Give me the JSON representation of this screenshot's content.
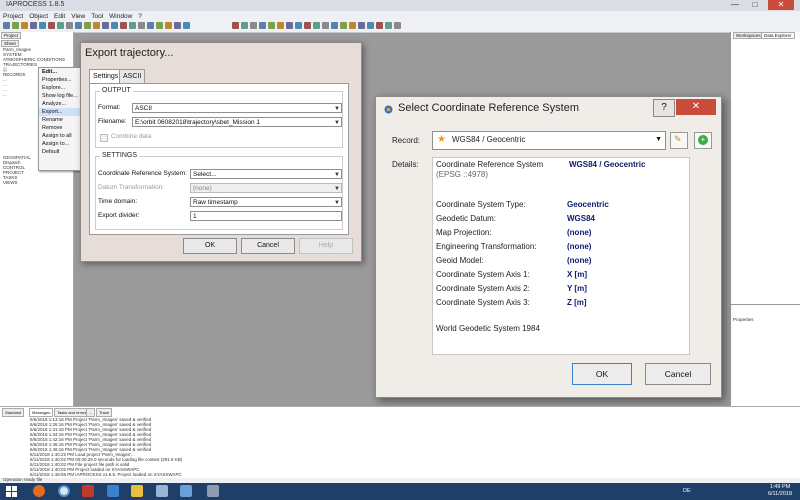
{
  "app": {
    "title": "IAPROCESS 1.8.5"
  },
  "menu": [
    "Project",
    "Object",
    "Edit",
    "View",
    "Tool",
    "Window",
    "?"
  ],
  "left_tabs": [
    "Project",
    "Sheet"
  ],
  "tree": [
    "Parm_Images",
    "SYSTEM",
    "ATMOSPHERIC CONDITIONS",
    "TRAJECTORIES",
    "...",
    "RECORDS",
    "...",
    "...",
    "...",
    "...",
    "GEOSPATIAL",
    "Dispatch",
    "CONTROL",
    "PROJECT",
    "TASKS",
    "VIEWS"
  ],
  "context_menu": [
    "Edit...",
    "Properties...",
    "Explore...",
    "Show log file...",
    "Analyze...",
    "Export...",
    "Rename",
    "Remove",
    "Assign to all",
    "Assign to...",
    "Default"
  ],
  "right_tabs": [
    "Workspaces",
    "Data Explorer"
  ],
  "right_props_label": "Properties",
  "export": {
    "title": "Export trajectory...",
    "tabs": [
      "Settings",
      "ASCII"
    ],
    "output_label": "OUTPUT",
    "format_label": "Format:",
    "format_value": "ASCII",
    "filename_label": "Filename:",
    "filename_value": "E:\\orbit 06082018\\trajectory\\sbet_Mission 1",
    "combine_label": "Combine data",
    "settings_label": "SETTINGS",
    "crs_label": "Coordinate Reference System:",
    "crs_value": "Select...",
    "datum_label": "Datum Transformation:",
    "datum_value": "(none)",
    "time_label": "Time domain:",
    "time_value": "Raw timestamp",
    "divider_label": "Export divider:",
    "divider_value": "1",
    "ok": "OK",
    "cancel": "Cancel",
    "help": "Help"
  },
  "crs": {
    "title": "Select Coordinate Reference System",
    "help_btn": "?",
    "record_label": "Record:",
    "record_value": "WGS84 / Geocentric",
    "details_label": "Details:",
    "desc_prefix": "Coordinate Reference System",
    "desc_name": "WGS84 / Geocentric",
    "desc_epsg": "(EPSG ::4978)",
    "rows": [
      {
        "label": "Coordinate System Type:",
        "value": "Geocentric"
      },
      {
        "label": "Geodetic Datum:",
        "value": "WGS84"
      },
      {
        "label": "Map Projection:",
        "value": "(none)"
      },
      {
        "label": "Engineering Transformation:",
        "value": "(none)"
      },
      {
        "label": "Geoid Model:",
        "value": "(none)"
      },
      {
        "label": "Coordinate System Axis 1:",
        "value": "X [m]"
      },
      {
        "label": "Coordinate System Axis 2:",
        "value": "Y [m]"
      },
      {
        "label": "Coordinate System Axis 3:",
        "value": "Z [m]"
      }
    ],
    "footer": "World Geodetic System 1984",
    "ok": "OK",
    "cancel": "Cancel"
  },
  "bottom_tabs": [
    "Standard",
    "Messages",
    "Tasks and errors",
    "...",
    "Trace"
  ],
  "log": [
    "6/6/2018 1:13:16 PM Project 'Parm_Images' saved & verified",
    "6/6/2018 1:26:16 PM Project 'Parm_Images' saved & verified",
    "6/6/2018 1:31:16 PM Project 'Parm_Images' saved & verified",
    "6/6/2018 1:34:16 PM Project 'Parm_Images' saved & verified",
    "6/6/2018 1:42:16 PM Project 'Parm_Images' saved & verified",
    "6/6/2018 1:46:16 PM Project 'Parm_Images' saved & verified",
    "6/6/2018 1:48:16 PM Project 'Parm_Images' saved & verified",
    "6/11/2018 1:40:22 PM Load project 'Parm_Images'...",
    "6/11/2018 1:40:02 PM 00:00:29.0 seconds for loading file context (291.8 KB)",
    "6/11/2018 1:40:02 PM File project file path is valid",
    "6/11/2018 1:40:02 PM Project loaded on SYASSWAPC",
    "6/11/2018 1:48:55 PM IAPROCESS v1.8.5: Project loaded on SYASSWAPC"
  ],
  "status": "Operation ready file",
  "tray": {
    "lang": "DE",
    "time": "1:49 PM",
    "date": "6/11/2018"
  },
  "colors": {
    "taskbar": "#1f3f69",
    "accent_blue": "#0d1a6b",
    "close_red": "#c94c3c",
    "highlight": "#cfe0f7"
  }
}
